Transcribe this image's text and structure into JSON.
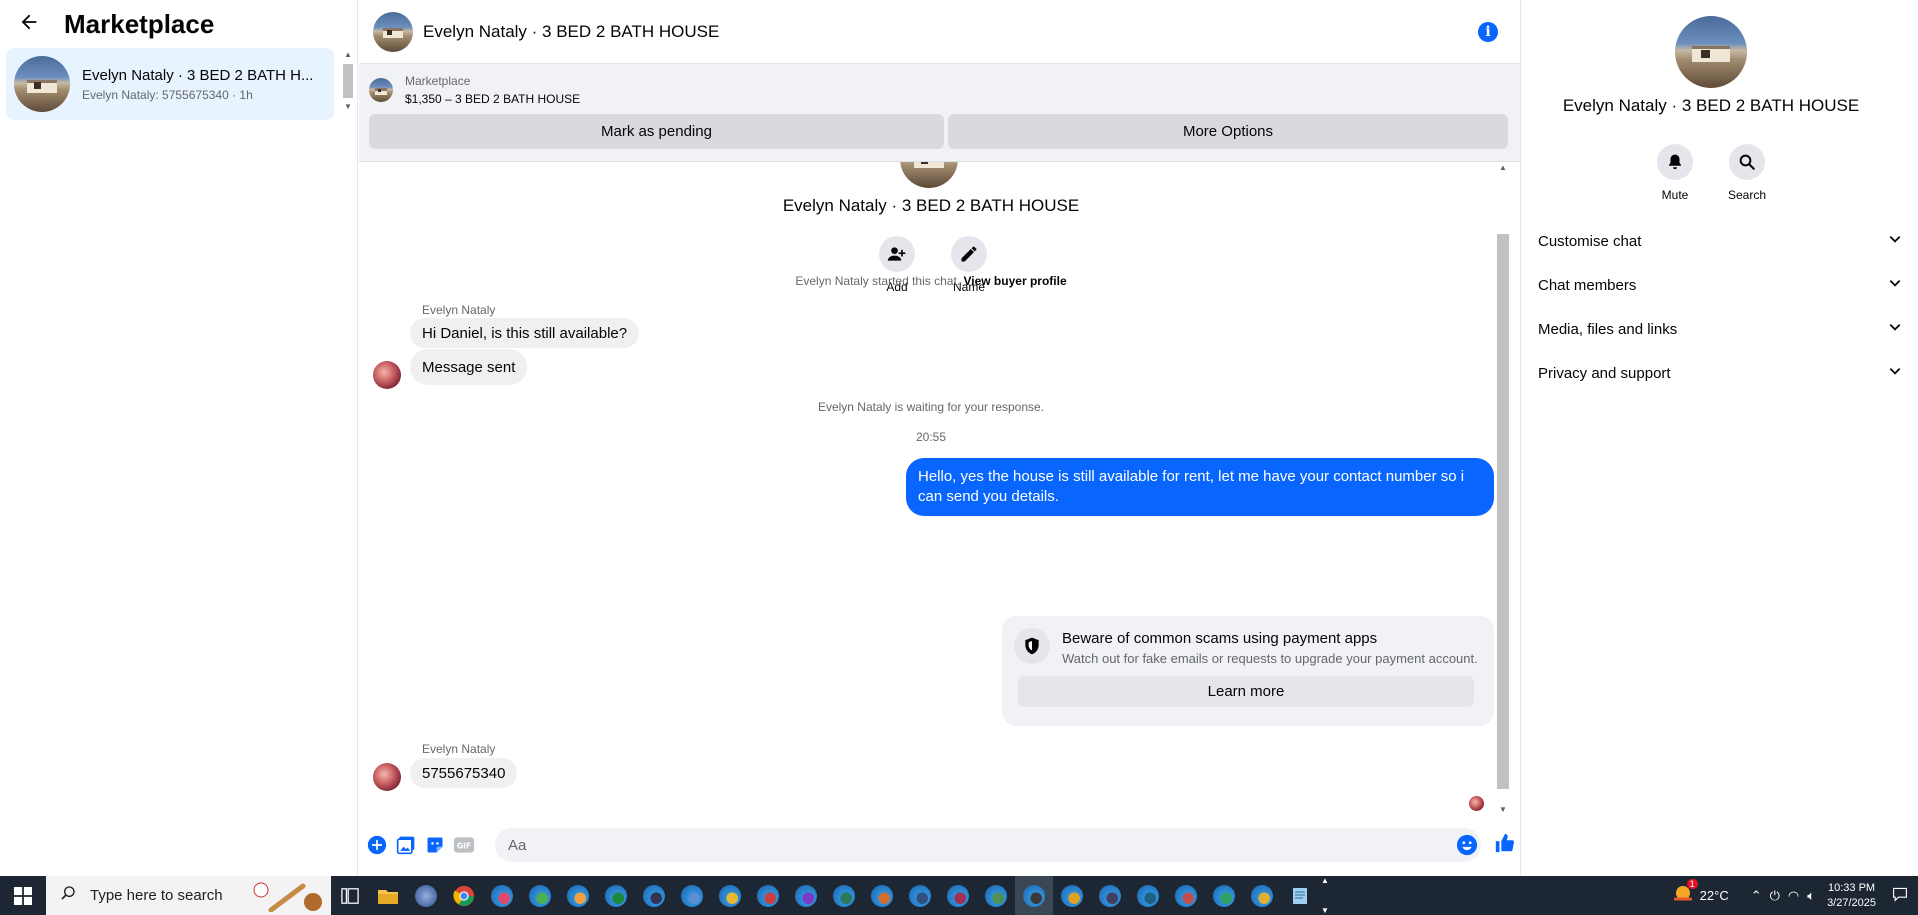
{
  "sidebar": {
    "title": "Marketplace",
    "conversations": [
      {
        "name": "Evelyn Nataly · 3 BED 2 BATH H...",
        "preview": "Evelyn Nataly: 5755675340 · 1h"
      }
    ]
  },
  "chat": {
    "header_title": "Evelyn Nataly · 3 BED 2 BATH HOUSE",
    "listing": {
      "source": "Marketplace",
      "summary": "$1,350 – 3 BED 2 BATH HOUSE",
      "pending_label": "Mark as pending",
      "more_label": "More Options"
    },
    "intro": {
      "name": "Evelyn Nataly · 3 BED 2 BATH HOUSE",
      "add_label": "Add",
      "name_label": "Name"
    },
    "started_text": "Evelyn Nataly started this chat.",
    "view_profile": "View buyer profile",
    "sender_name": "Evelyn Nataly",
    "incoming_1": "Hi Daniel, is this still available?",
    "incoming_2": "Message sent",
    "waiting_text": "Evelyn Nataly is waiting for your response.",
    "timestamp": "20:55",
    "outgoing_1": "Hello, yes the house is still available for rent, let me have your contact number so i can send you details.",
    "scam_title": "Beware of common scams using payment apps",
    "scam_desc": "Watch out for fake emails or requests to upgrade your payment account.",
    "learn_more": "Learn more",
    "sender_name_2": "Evelyn Nataly",
    "incoming_3": "5755675340",
    "composer_placeholder": "Aa",
    "accent_color": "#0866ff"
  },
  "info_panel": {
    "name": "Evelyn Nataly · 3 BED 2 BATH HOUSE",
    "mute_label": "Mute",
    "search_label": "Search",
    "sections": [
      "Customise chat",
      "Chat members",
      "Media, files and links",
      "Privacy and support"
    ]
  },
  "taskbar": {
    "search_placeholder": "Type here to search",
    "temperature": "22°C",
    "time": "10:33 PM",
    "date": "3/27/2025",
    "weather_badge": "1"
  }
}
